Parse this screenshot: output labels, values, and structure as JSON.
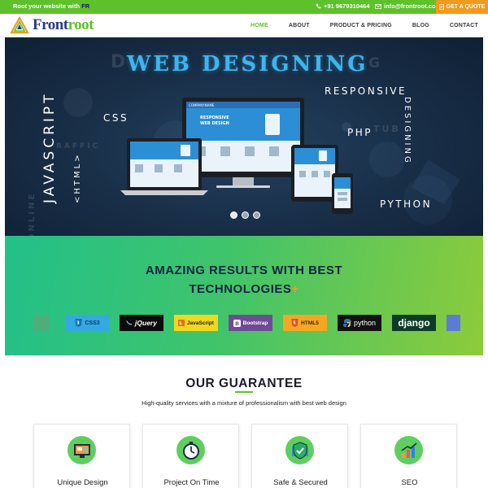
{
  "topbar": {
    "tagline_prefix": "Root your website with ",
    "tagline_brand": "FR",
    "phone": "+91 9679310464",
    "email": "info@frontroot.co",
    "quote_label": "GET A QUOTE"
  },
  "header": {
    "logo_main": "Front",
    "logo_accent": "root",
    "nav": [
      "HOME",
      "ABOUT",
      "PRODUCT & PRICING",
      "BLOG",
      "CONTACT"
    ],
    "active": "HOME"
  },
  "hero": {
    "title": "WEB DESIGNING",
    "left_vertical": "JAVASCRIPT",
    "left_vertical_sub": "<HTML>",
    "css": "CSS",
    "responsive": "RESPONSIVE",
    "designing": "DESIGNING",
    "php": "PHP",
    "python": "PYTHON",
    "screen_brand": "COMPANYNAME",
    "screen_headline_1": "RESPONSIVE",
    "screen_headline_2": "WEB DESIGN",
    "slides": 3,
    "active_slide": 1
  },
  "band": {
    "title_line1": "AMAZING RESULTS WITH BEST",
    "title_line2": "TECHNOLOGIES",
    "title_plus": "+",
    "technologies": [
      "CSS3",
      "jQuery",
      "JavaScript",
      "Bootstrap",
      "HTML5",
      "python",
      "django"
    ]
  },
  "guarantee": {
    "title": "OUR GUARANTEE",
    "subtitle": "High-quality services with a mixture of professionalism with best web design",
    "cards": [
      "Unique Design",
      "Project On Time",
      "Safe & Secured",
      "SEO"
    ]
  },
  "colors": {
    "green": "#5ec12b",
    "orange": "#f29a1f",
    "navy": "#0f2445",
    "hero_title": "#3db5ef"
  }
}
